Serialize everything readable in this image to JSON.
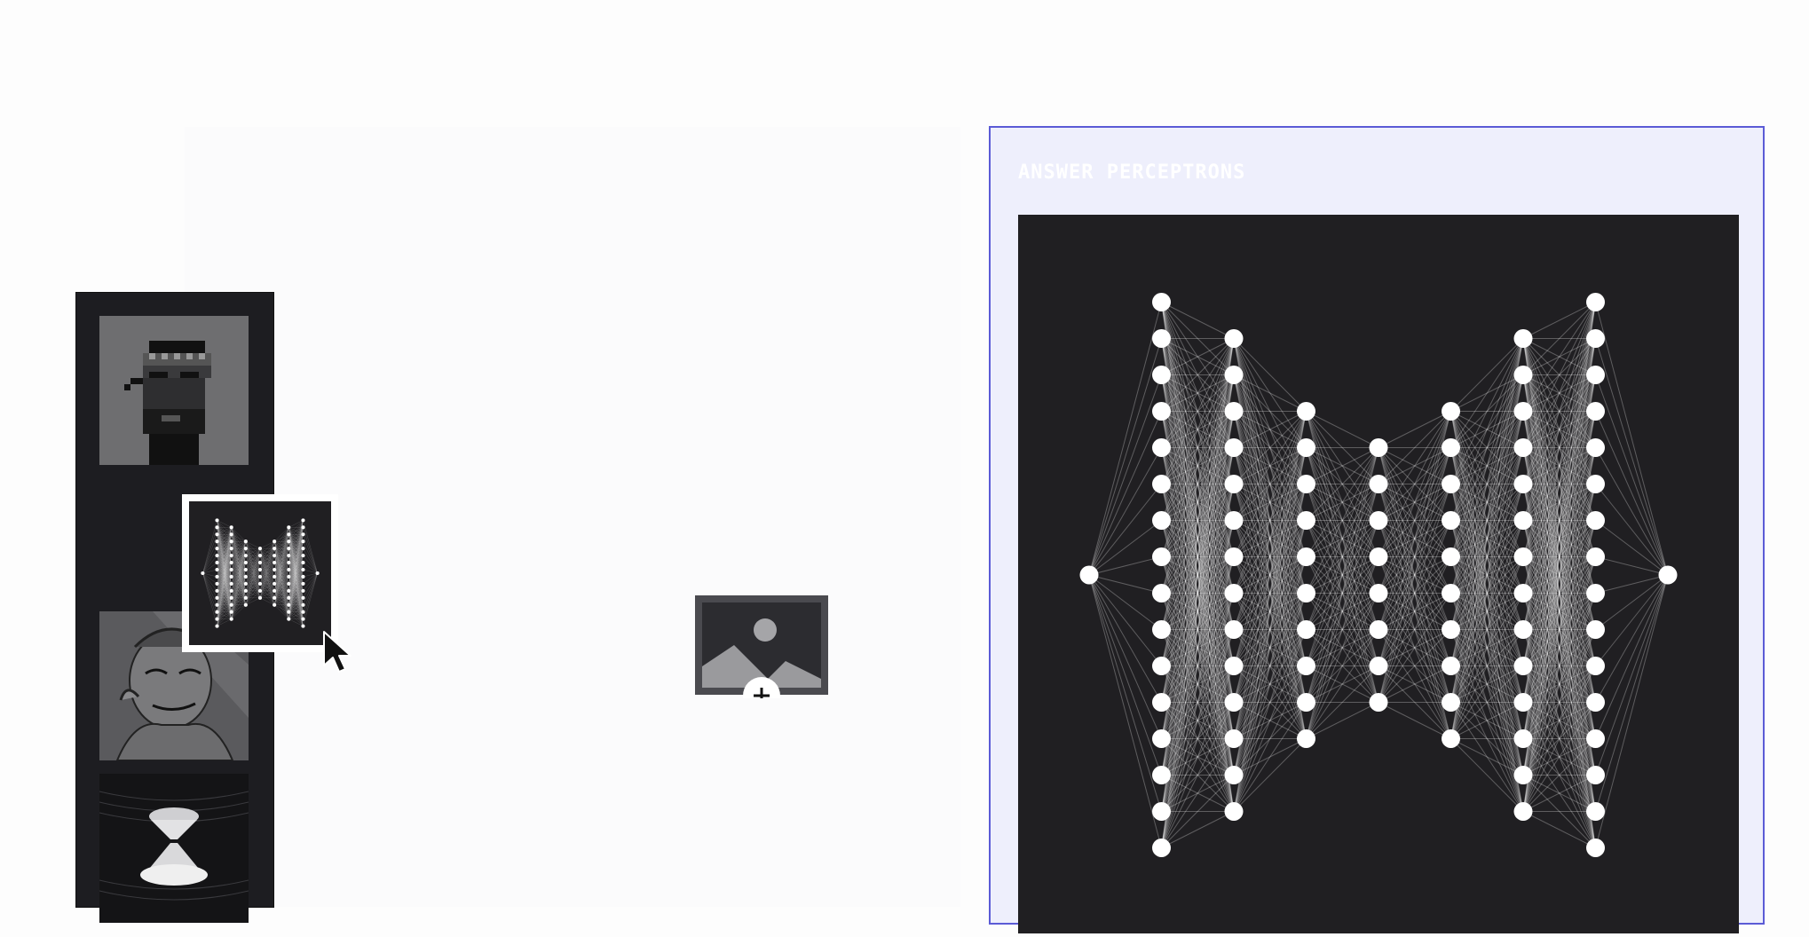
{
  "answer_card": {
    "title": "ANSWER PERCEPTRONS"
  },
  "drop_zone": {
    "icon": "add-image-icon"
  },
  "thumbnail_strip": {
    "items": [
      {
        "icon": "pixel-punk-portrait"
      },
      {
        "icon": "neural-network-thumbnail"
      },
      {
        "icon": "sketch-portrait"
      },
      {
        "icon": "hourglass-art"
      }
    ]
  },
  "neural_network": {
    "layers": [
      1,
      16,
      14,
      10,
      8,
      10,
      14,
      16,
      1
    ]
  },
  "colors": {
    "accent_border": "#5b5bd6",
    "card_background": "#eeeffc",
    "canvas_background": "#201f22",
    "node": "#ffffff"
  }
}
